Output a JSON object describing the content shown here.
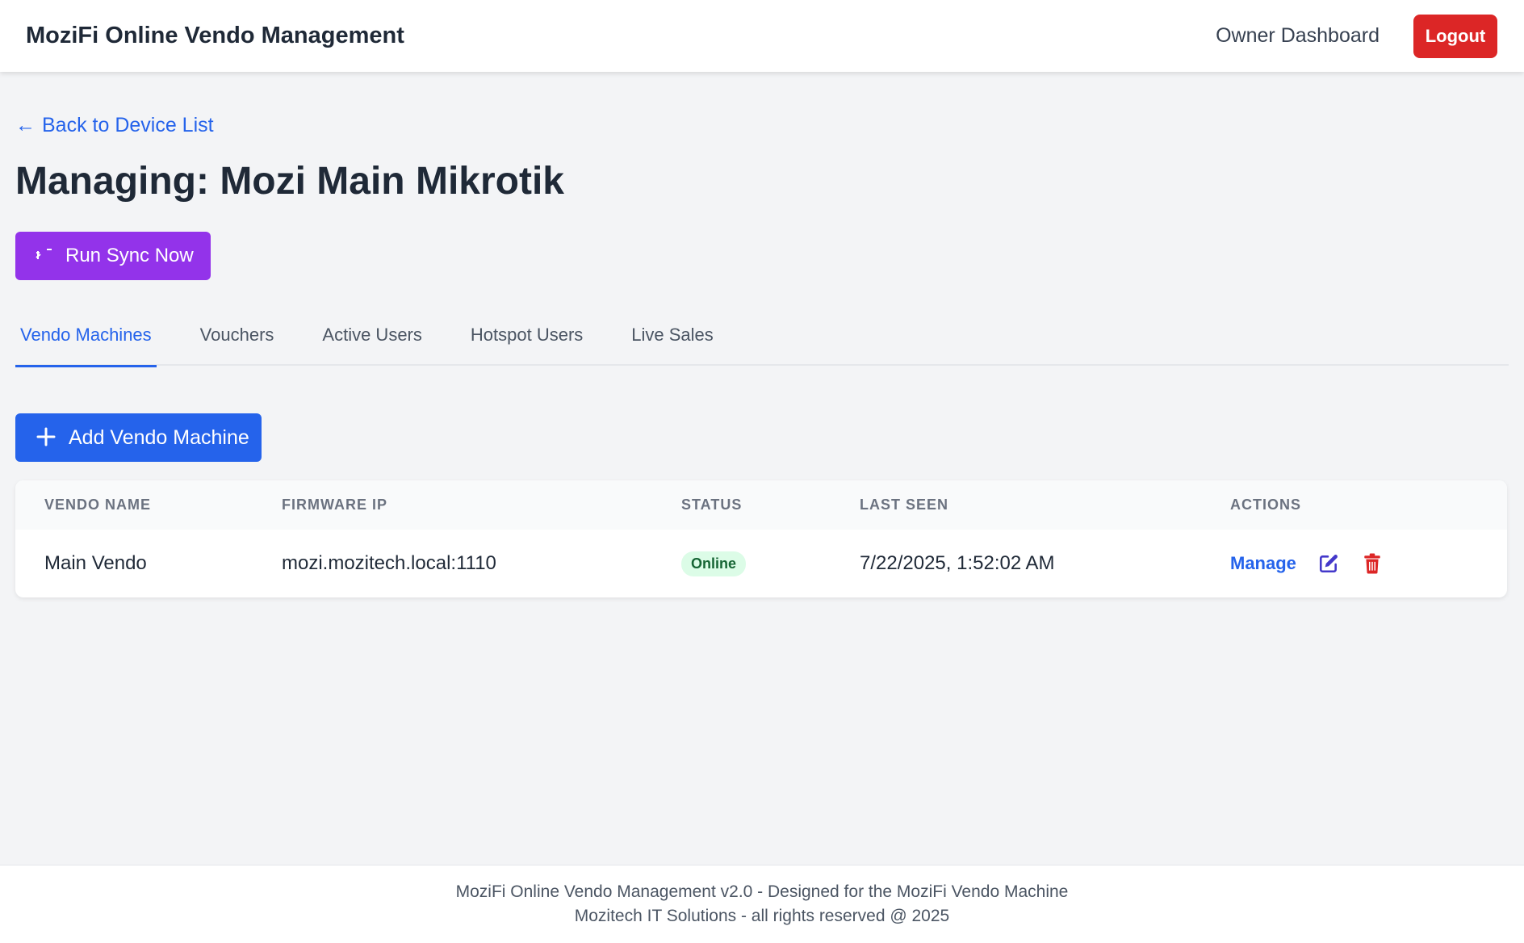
{
  "header": {
    "brand": "MoziFi Online Vendo Management",
    "owner_dashboard": "Owner Dashboard",
    "logout": "Logout"
  },
  "main": {
    "back_link": "Back to Device List",
    "back_arrow": "←",
    "title": "Managing: Mozi Main Mikrotik",
    "sync_button": "Run Sync Now",
    "tabs": [
      {
        "label": "Vendo Machines",
        "active": true
      },
      {
        "label": "Vouchers",
        "active": false
      },
      {
        "label": "Active Users",
        "active": false
      },
      {
        "label": "Hotspot Users",
        "active": false
      },
      {
        "label": "Live Sales",
        "active": false
      }
    ],
    "add_button": "Add Vendo Machine",
    "table": {
      "columns": [
        "VENDO NAME",
        "FIRMWARE IP",
        "STATUS",
        "LAST SEEN",
        "ACTIONS"
      ],
      "rows": [
        {
          "name": "Main Vendo",
          "firmware_ip": "mozi.mozitech.local:1110",
          "status": "Online",
          "last_seen": "7/22/2025, 1:52:02 AM",
          "manage": "Manage"
        }
      ]
    }
  },
  "footer": {
    "line1": "MoziFi Online Vendo Management v2.0 - Designed for the MoziFi Vendo Machine",
    "line2": "Mozitech IT Solutions - all rights reserved @ 2025"
  },
  "colors": {
    "primary": "#2563eb",
    "danger": "#dc2626",
    "sync": "#9333ea",
    "status_online_bg": "#dcfce7",
    "status_online_text": "#166534",
    "edit_icon": "#4338ca"
  },
  "icons": {
    "sync": "sync-icon",
    "add": "plus-icon",
    "edit": "edit-icon",
    "delete": "trash-icon"
  }
}
